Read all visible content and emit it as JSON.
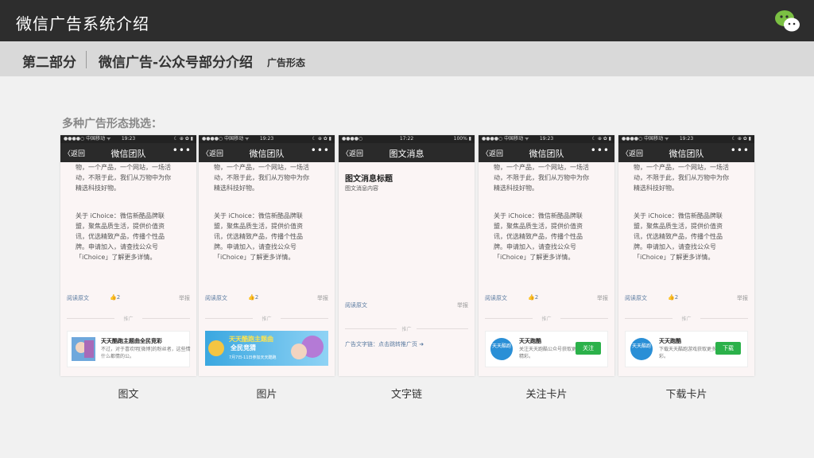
{
  "header": {
    "title": "微信广告系统介绍"
  },
  "subheader": {
    "part": "第二部分",
    "section": "微信广告-公众号部分介绍",
    "sub": "广告形态"
  },
  "intro": "多种广告形态挑选：",
  "phones": [
    {
      "caption": "图文",
      "status": {
        "carrier": "●●●●○ 中国移动 ᯤ",
        "time": "19:23",
        "right": "☾ ⊕ ✿ ▮"
      },
      "nav": {
        "back": "〈返回",
        "title": "微信团队",
        "more": "•••"
      },
      "body_lines": [
        "物，一个产品，一个网站，一场活",
        "动，不限于此，我们从万物中为你",
        "精选科技好物。"
      ],
      "about_lines": [
        "关于 iChoice：微信新酷品牌联",
        "盟，聚焦品质生活，提供价值资",
        "讯，优选精致产品，传播个性品",
        "牌。申请加入，请查找公众号",
        "「iChoice」了解更多详情。"
      ],
      "meta": {
        "read": "阅读原文",
        "like": "👍2",
        "report": "举报"
      },
      "promo_label": "推广",
      "ad": {
        "title": "天天酷跑主题曲全民竞彩",
        "desc": "不过，对于喜欢明[微博]的粉丝者，这些情什么都情的公。"
      }
    },
    {
      "caption": "图片",
      "status": {
        "carrier": "●●●●○ 中国移动 ᯤ",
        "time": "19:23",
        "right": "☾ ⊕ ✿ ▮"
      },
      "nav": {
        "back": "〈返回",
        "title": "微信团队",
        "more": "•••"
      },
      "body_lines": [
        "物，一个产品，一个网站，一场活",
        "动，不限于此，我们从万物中为你",
        "精选科技好物。"
      ],
      "about_lines": [
        "关于 iChoice：微信新酷品牌联",
        "盟，聚焦品质生活，提供价值资",
        "讯，优选精致产品，传播个性品",
        "牌。申请加入，请查找公众号",
        "「iChoice」了解更多详情。"
      ],
      "meta": {
        "read": "阅读原文",
        "like": "👍2",
        "report": "举报"
      },
      "promo_label": "推广",
      "banner": {
        "line1": "天天酷跑主题曲",
        "line2": "全民竞猜",
        "line3": "7月7日-11日参加天天酷跑"
      }
    },
    {
      "caption": "文字链",
      "status": {
        "carrier": "●●●●○",
        "time": "17:22",
        "right": "100% ▮"
      },
      "nav": {
        "back": "〈返回",
        "title": "图文消息",
        "more": ""
      },
      "msg_title": "图文消息标题",
      "msg_content": "图文消息内容",
      "meta": {
        "read": "阅读原文",
        "like": "",
        "report": "举报"
      },
      "promo_label": "推广",
      "text_link": "广告文字链：点击跳转推广页 ➜"
    },
    {
      "caption": "关注卡片",
      "status": {
        "carrier": "●●●●○ 中国移动 ᯤ",
        "time": "19:23",
        "right": "☾ ⊕ ✿ ▮"
      },
      "nav": {
        "back": "〈返回",
        "title": "微信团队",
        "more": "•••"
      },
      "body_lines": [
        "物，一个产品，一个网站，一场活",
        "动，不限于此，我们从万物中为你",
        "精选科技好物。"
      ],
      "about_lines": [
        "关于 iChoice：微信新酷品牌联",
        "盟，聚焦品质生活，提供价值资",
        "讯，优选精致产品，传播个性品",
        "牌。申请加入，请查找公众号",
        "「iChoice」了解更多详情。"
      ],
      "meta": {
        "read": "阅读原文",
        "like": "👍2",
        "report": "举报"
      },
      "promo_label": "推广",
      "card": {
        "title": "天天跑酷",
        "desc": "关注天天跑酷公众号获取更多精彩。",
        "button": "关注",
        "logo": "天天酷跑"
      }
    },
    {
      "caption": "下载卡片",
      "status": {
        "carrier": "●●●●○ 中国移动 ᯤ",
        "time": "19:23",
        "right": "☾ ⊕ ✿ ▮"
      },
      "nav": {
        "back": "〈返回",
        "title": "微信团队",
        "more": "•••"
      },
      "body_lines": [
        "物，一个产品，一个网站，一场活",
        "动，不限于此，我们从万物中为你",
        "精选科技好物。"
      ],
      "about_lines": [
        "关于 iChoice：微信新酷品牌联",
        "盟，聚焦品质生活，提供价值资",
        "讯，优选精致产品，传播个性品",
        "牌。申请加入，请查找公众号",
        "「iChoice」了解更多详情。"
      ],
      "meta": {
        "read": "阅读原文",
        "like": "👍2",
        "report": "举报"
      },
      "promo_label": "推广",
      "card": {
        "title": "天天跑酷",
        "desc": "下载天天酷跑游戏获取更多精彩。",
        "button": "下载",
        "logo": "天天酷跑"
      }
    }
  ],
  "colors": {
    "topbar": "#2d2d2d",
    "subbar": "#d9d9d9",
    "button_green": "#2bb14a",
    "link_blue": "#5a7aa0"
  }
}
